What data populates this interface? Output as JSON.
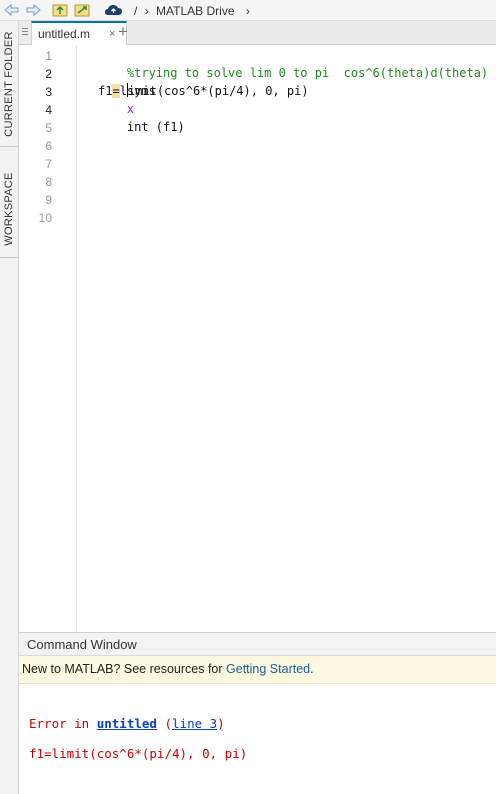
{
  "toolbar": {
    "icons": [
      "back-arrow-icon",
      "forward-arrow-icon",
      "up-folder-icon",
      "browse-folder-icon",
      "matlab-drive-cloud-icon"
    ],
    "path": {
      "root": "/",
      "separator": "›",
      "folder": "MATLAB Drive",
      "trailing_separator": "›"
    }
  },
  "side_tabs": {
    "current_folder": "CURRENT FOLDER",
    "workspace": "WORKSPACE"
  },
  "editor_tabs": {
    "file_name": "untitled.m",
    "close_glyph": "×",
    "add_glyph": "+"
  },
  "editor": {
    "line_numbers": [
      "1",
      "2",
      "3",
      "4",
      "5",
      "6",
      "7",
      "8",
      "9",
      "10"
    ],
    "lines": {
      "comment": "%trying to solve lim 0 to pi  cos^6(theta)d(theta)",
      "syms_keyword": "syms",
      "syms_var": "x",
      "line3_prefix": "f1",
      "line3_eq": "=",
      "line3_l": "l",
      "line3_rest": "imit(cos^6*(pi/4), 0, pi)",
      "line4": "int (f1)"
    },
    "colors": {
      "comment": "#228b22",
      "variable": "#a020f0",
      "highlight": "#f6dfa6"
    }
  },
  "command_window": {
    "title": "Command Window",
    "banner_text": "New to MATLAB? See resources for ",
    "banner_link": "Getting Started",
    "banner_period": ".",
    "error": {
      "prefix": "Error in ",
      "file_link": "untitled",
      "open_paren": " (",
      "line_link": "line 3",
      "close_paren": ")",
      "code": "f1=limit(cos^6*(pi/4), 0, pi)"
    },
    "colors": {
      "error": "#cc0000",
      "link": "#0b3fbb"
    }
  }
}
